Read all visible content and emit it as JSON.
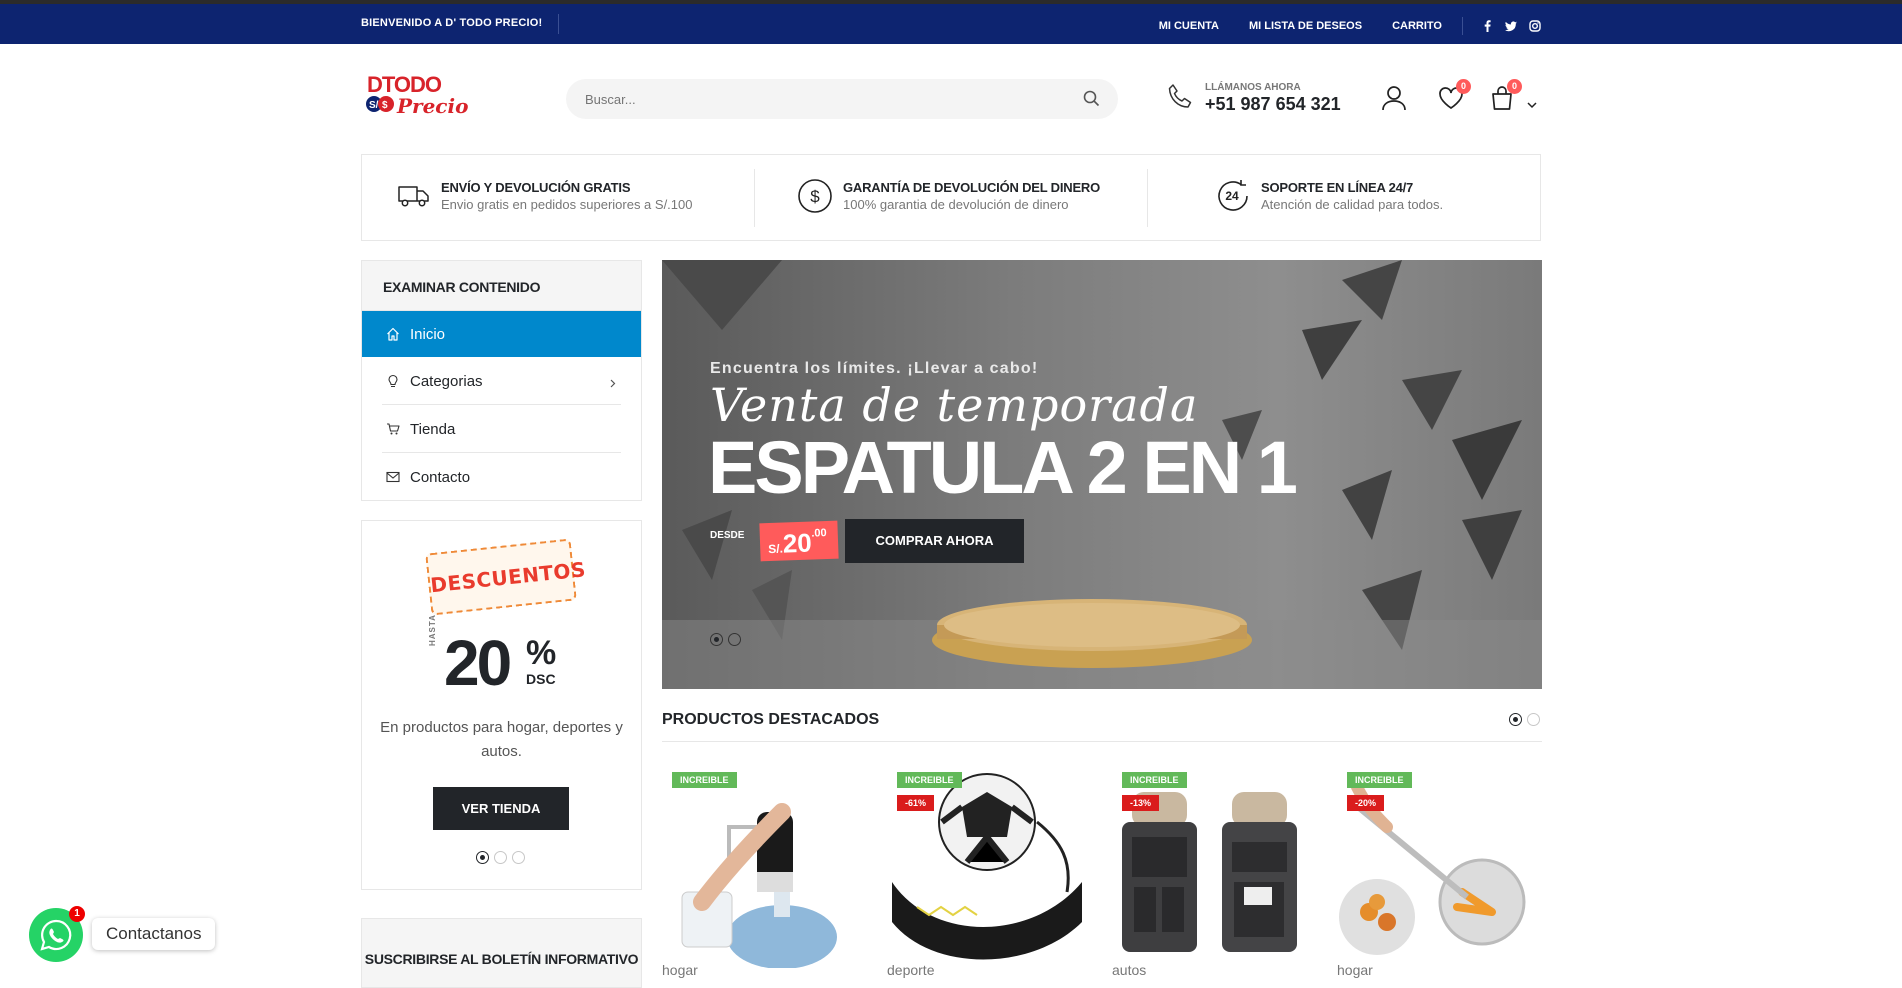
{
  "topbar": {
    "welcome": "BIENVENIDO A D' TODO PRECIO!",
    "links": [
      "MI CUENTA",
      "MI LISTA DE DESEOS",
      "CARRITO"
    ],
    "social_icons": [
      "facebook-icon",
      "twitter-icon",
      "instagram-icon"
    ],
    "bg_color": "#0d2470"
  },
  "header": {
    "logo_text_top": "DTODO",
    "logo_text_bottom": "Precio",
    "search_placeholder": "Buscar...",
    "call_label": "LLÁMANOS AHORA",
    "phone": "+51 987 654 321",
    "wishlist_count": "0",
    "cart_count": "0"
  },
  "info_boxes": [
    {
      "icon": "truck-icon",
      "title": "ENVÍO Y DEVOLUCIÓN GRATIS",
      "text": "Envio gratis en pedidos superiores a S/.100"
    },
    {
      "icon": "dollar-icon",
      "title": "GARANTÍA DE DEVOLUCIÓN DEL DINERO",
      "text": "100% garantia de devolución de dinero"
    },
    {
      "icon": "support-24-icon",
      "title": "SOPORTE EN LÍNEA 24/7",
      "text": "Atención de calidad para todos."
    }
  ],
  "sidebar": {
    "heading": "EXAMINAR CONTENIDO",
    "items": [
      {
        "label": "Inicio",
        "icon": "home-icon",
        "active": true
      },
      {
        "label": "Categorias",
        "icon": "categories-icon",
        "has_submenu": true
      },
      {
        "label": "Tienda",
        "icon": "cart-icon"
      },
      {
        "label": "Contacto",
        "icon": "mail-icon"
      }
    ],
    "accent_color": "#0088cc"
  },
  "promo": {
    "stamp": "DESCUENTOS",
    "hasta": "HASTA",
    "value": "20",
    "percent": "%",
    "dsc": "DSC",
    "description": "En productos para hogar, deportes y autos.",
    "button": "VER TIENDA"
  },
  "newsletter": {
    "title": "SUSCRIBIRSE AL BOLETÍN INFORMATIVO"
  },
  "slider": {
    "subtitle": "Encuentra los límites. ¡Llevar a cabo!",
    "script_title": "Venta de temporada",
    "title": "ESPATULA 2 EN 1",
    "from_label": "DESDE",
    "currency": "S/.",
    "price": "20",
    "cents": ".00",
    "cta": "COMPRAR AHORA"
  },
  "featured": {
    "title": "PRODUCTOS DESTACADOS",
    "products": [
      {
        "label": "INCREIBLE",
        "discount": "",
        "category": "hogar"
      },
      {
        "label": "INCREIBLE",
        "discount": "-61%",
        "category": "deporte"
      },
      {
        "label": "INCREIBLE",
        "discount": "-13%",
        "category": "autos"
      },
      {
        "label": "INCREIBLE",
        "discount": "-20%",
        "category": "hogar"
      }
    ]
  },
  "whatsapp": {
    "label": "Contactanos",
    "count": "1"
  }
}
